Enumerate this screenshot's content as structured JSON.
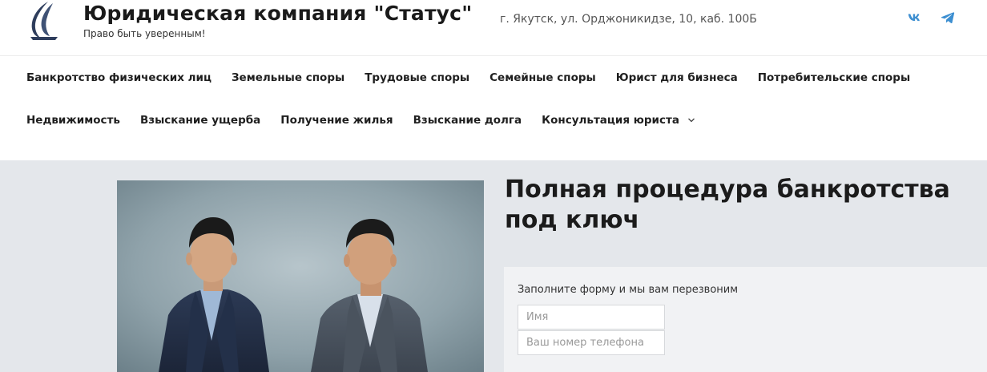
{
  "header": {
    "title": "Юридическая компания \"Статус\"",
    "tagline": "Право быть уверенным!",
    "address": "г. Якутск, ул. Орджоникидзе, 10, каб. 100Б",
    "social": [
      {
        "icon": "vk-icon",
        "label": "VK"
      },
      {
        "icon": "telegram-icon",
        "label": "Telegram"
      }
    ]
  },
  "nav": {
    "row1": [
      "Банкротство физических лиц",
      "Земельные споры",
      "Трудовые споры",
      "Семейные споры",
      "Юрист для бизнеса",
      "Потребительские споры"
    ],
    "row2": [
      "Недвижимость",
      "Взыскание ущерба",
      "Получение жилья",
      "Взыскание долга",
      "Консультация юриста"
    ]
  },
  "hero": {
    "title": "Полная процедура банкротства под ключ",
    "form": {
      "caption": "Заполните форму и мы вам перезвоним",
      "name_placeholder": "Имя",
      "phone_placeholder": "Ваш номер телефона"
    }
  },
  "colors": {
    "logo": "#2e3d5c",
    "social": "#3d8fd1",
    "hero_bg": "#e4e7eb",
    "text": "#1b1b1b"
  }
}
